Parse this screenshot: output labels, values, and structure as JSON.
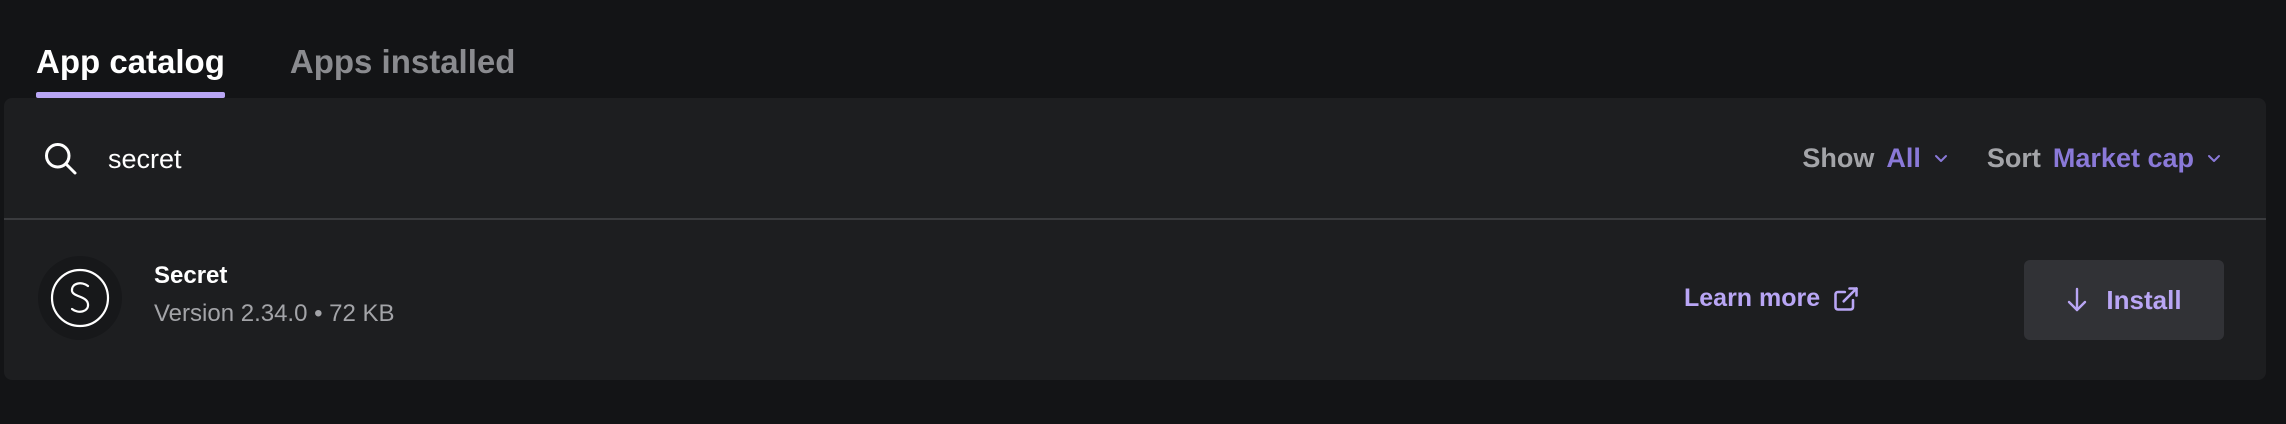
{
  "tabs": [
    {
      "label": "App catalog",
      "active": true
    },
    {
      "label": "Apps installed",
      "active": false
    }
  ],
  "search": {
    "value": "secret",
    "icon": "search-icon"
  },
  "filters": {
    "show": {
      "label": "Show",
      "value": "All"
    },
    "sort": {
      "label": "Sort",
      "value": "Market cap"
    }
  },
  "app": {
    "name": "Secret",
    "meta": "Version 2.34.0 • 72 KB",
    "icon": "secret-logo-icon",
    "learn_more": "Learn more",
    "install": "Install"
  },
  "colors": {
    "background": "#131416",
    "panel": "#1d1e20",
    "accent": "#b9a6f5",
    "filter_value": "#8a79d8",
    "button_bg": "#313236"
  }
}
